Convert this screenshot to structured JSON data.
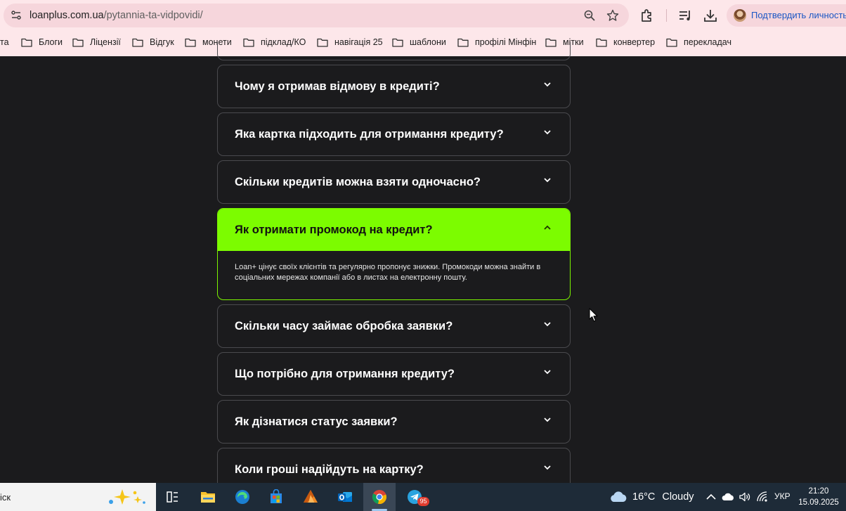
{
  "browser": {
    "url_host": "loanplus.com.ua",
    "url_path": "/pytannia-ta-vidpovidi/",
    "profile_label": "Подтвердить личность",
    "bookmarks": [
      {
        "label": "та"
      },
      {
        "label": "Блоги"
      },
      {
        "label": "Ліцензії"
      },
      {
        "label": "Відгук"
      },
      {
        "label": "монети"
      },
      {
        "label": "підклад/КО"
      },
      {
        "label": "навігація 25"
      },
      {
        "label": "шаблони"
      },
      {
        "label": "профілі Мінфін"
      },
      {
        "label": "мітки"
      },
      {
        "label": "конвертер"
      },
      {
        "label": "перекладач"
      }
    ]
  },
  "faq": {
    "items": [
      {
        "question": "Чому я отримав відмову в кредиті?",
        "expanded": false
      },
      {
        "question": "Яка картка підходить для отримання кредиту?",
        "expanded": false
      },
      {
        "question": "Скільки кредитів можна взяти одночасно?",
        "expanded": false
      },
      {
        "question": "Як отримати промокод на кредит?",
        "expanded": true,
        "answer": "Loan+ цінує своїх клієнтів та регулярно пропонує знижки. Промокоди можна знайти в соціальних мережах компанії або в листах на електронну пошту."
      },
      {
        "question": "Скільки часу займає обробка заявки?",
        "expanded": false
      },
      {
        "question": "Що потрібно для отримання кредиту?",
        "expanded": false
      },
      {
        "question": "Як дізнатися статус заявки?",
        "expanded": false
      },
      {
        "question": "Коли гроші надійдуть на картку?",
        "expanded": false
      }
    ],
    "accent_color": "#7cfc00"
  },
  "taskbar": {
    "search_text": "іск",
    "apps": [
      "task-view",
      "file-explorer",
      "edge",
      "microsoft-store",
      "affinity",
      "outlook",
      "chrome",
      "telegram"
    ],
    "telegram_badge": "95",
    "weather_temp": "16°C",
    "weather_condition": "Cloudy",
    "language": "УКР",
    "time": "21:20",
    "date": "15.09.2025"
  }
}
